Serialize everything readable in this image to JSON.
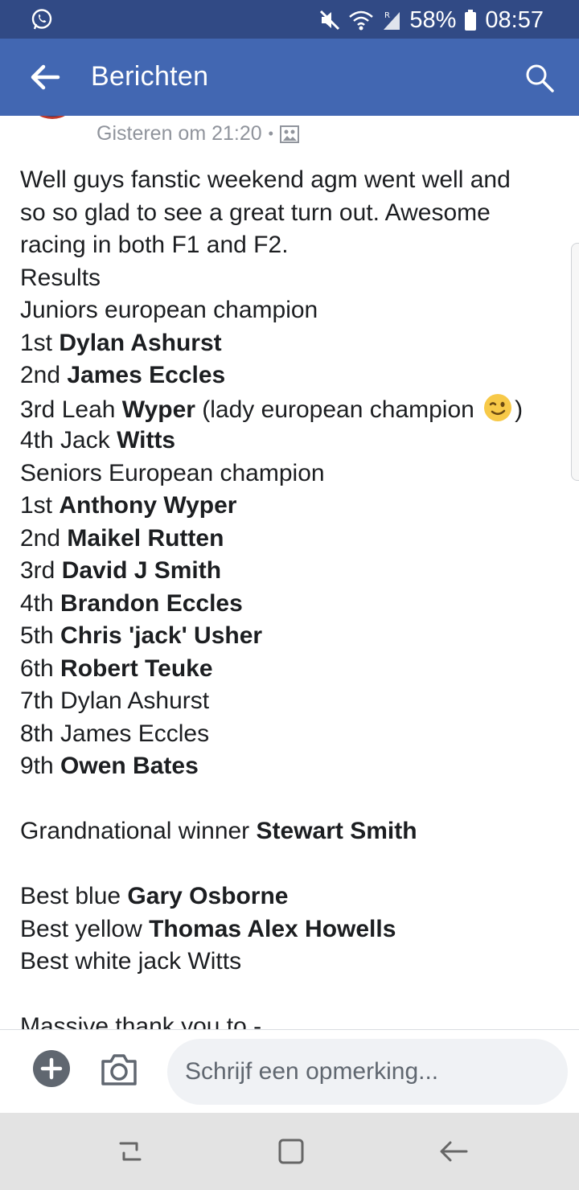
{
  "status_bar": {
    "battery_percent": "58%",
    "time": "08:57",
    "icons": [
      "whatsapp-icon",
      "mute-icon",
      "wifi-icon",
      "signal-icon",
      "battery-icon"
    ]
  },
  "app_bar": {
    "title": "Berichten",
    "icons": [
      "back-arrow-icon",
      "search-icon"
    ]
  },
  "post": {
    "timestamp": "Gisteren om 21:20",
    "separator": "•",
    "lines": [
      {
        "plain": "Well guys fanstic weekend agm went well and"
      },
      {
        "plain": "so so glad to see a great turn out. Awesome"
      },
      {
        "plain": "racing in both F1 and F2."
      },
      {
        "plain": "Results"
      },
      {
        "plain": "Juniors european champion"
      },
      {
        "prefix": "1st ",
        "bold": "Dylan Ashurst"
      },
      {
        "prefix": "2nd ",
        "bold": "James Eccles"
      },
      {
        "prefix": "3rd Leah ",
        "bold": "Wyper",
        "suffix": " (lady european champion ",
        "suffix2": ")"
      },
      {
        "prefix": "4th Jack ",
        "bold": "Witts"
      },
      {
        "plain": "Seniors European champion"
      },
      {
        "prefix": "1st ",
        "bold": "Anthony Wyper"
      },
      {
        "prefix": "2nd ",
        "bold": "Maikel Rutten"
      },
      {
        "prefix": "3rd ",
        "bold": "David J Smith"
      },
      {
        "prefix": "4th ",
        "bold": "Brandon Eccles"
      },
      {
        "prefix": "5th ",
        "bold": "Chris 'jack' Usher"
      },
      {
        "prefix": "6th ",
        "bold": "Robert Teuke"
      },
      {
        "plain": "7th Dylan Ashurst"
      },
      {
        "plain": "8th James Eccles"
      },
      {
        "prefix": "9th ",
        "bold": "Owen Bates"
      },
      {
        "prefix": "Grandnational winner ",
        "bold": "Stewart Smith"
      },
      {
        "prefix": "Best blue ",
        "bold": "Gary Osborne"
      },
      {
        "prefix": "Best yellow ",
        "bold": "Thomas Alex Howells"
      },
      {
        "plain": "Best white jack Witts"
      },
      {
        "plain": "Massive thank you to -"
      }
    ],
    "emoji": "winking-face-emoji"
  },
  "comment_bar": {
    "placeholder": "Schrijf een opmerking...",
    "icons": [
      "add-icon",
      "camera-icon"
    ]
  },
  "nav_bar": {
    "icons": [
      "recent-apps-icon",
      "home-icon",
      "back-icon"
    ]
  },
  "colors": {
    "status_bar": "#314a85",
    "app_bar": "#4267b2",
    "text": "#1c1e21",
    "meta_text": "#90949c",
    "input_bg": "#f0f2f5",
    "nav_bar": "#e3e3e3"
  }
}
